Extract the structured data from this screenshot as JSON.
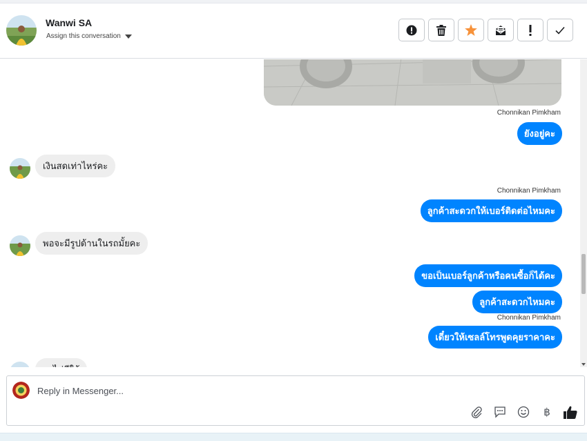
{
  "header": {
    "contact_name": "Wanwi SA",
    "assign_label": "Assign this conversation",
    "actions": [
      {
        "name": "spam-icon"
      },
      {
        "name": "trash-icon"
      },
      {
        "name": "star-icon",
        "color": "#f7923a"
      },
      {
        "name": "mark-unread-icon"
      },
      {
        "name": "follow-up-icon"
      },
      {
        "name": "done-icon"
      }
    ]
  },
  "thread": {
    "messages": [
      {
        "sender": "Chonnikan Pimkham",
        "text": "ยังอยู่คะ"
      },
      {
        "text": "เงินสดเท่าไหร่คะ"
      },
      {
        "sender": "Chonnikan Pimkham",
        "text": "ลูกค้าสะดวกให้เบอร์ติดต่อไหมคะ"
      },
      {
        "text": "พอจะมีรูปด้านในรถมั้ยคะ"
      },
      {
        "text": "ขอเป็นเบอร์ลูกค้าหรือคนซื้อก็ได้คะ"
      },
      {
        "text": "ลูกค้าสะดวกไหมคะ"
      },
      {
        "sender": "Chonnikan Pimkham",
        "text": "เดี๋ยวให้เซลล์โทรพูดคุยราคาคะ"
      },
      {
        "text": "ดูงไม่มีให้"
      }
    ]
  },
  "composer": {
    "placeholder": "Reply in Messenger...",
    "tools": [
      "attachment-icon",
      "saved-reply-icon",
      "emoji-icon",
      "baht-icon",
      "like-icon"
    ],
    "baht_symbol": "฿"
  },
  "colors": {
    "outgoing_bubble": "#0084ff",
    "incoming_bubble": "#eeeeee",
    "star": "#f7923a"
  }
}
